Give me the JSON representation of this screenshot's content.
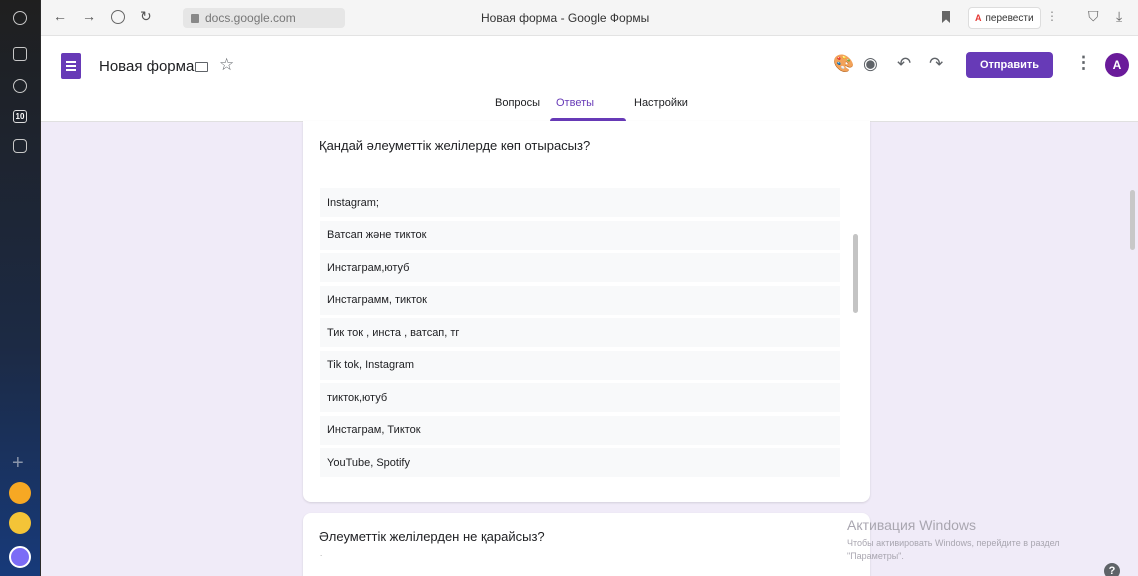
{
  "browser": {
    "url": "docs.google.com",
    "tab_title": "Новая форма - Google Формы",
    "translate_label": "перевести",
    "translate_icon_text": "A",
    "sidebar_badge": "10"
  },
  "form_header": {
    "title": "Новая форма",
    "send_label": "Отправить",
    "avatar_letter": "A",
    "tabs": [
      {
        "label": "Вопросы"
      },
      {
        "label": "Ответы"
      },
      {
        "label": "Настройки"
      }
    ]
  },
  "questions": [
    {
      "title": "Қандай әлеуметтік желілерде көп отырасыз?",
      "answers": [
        "Instagram;",
        "Ватсап және тикток",
        "Инстаграм,ютуб",
        "Инстаграмм, тикток",
        "Тик ток , инста , ватсап, тг",
        "Tik tok, Instagram",
        "тикток,ютуб",
        "Инстаграм, Тикток",
        "YouTube, Spotify"
      ]
    },
    {
      "title": "Әлеуметтік желілерден не қарайсыз?",
      "note": "."
    }
  ],
  "watermark": {
    "title": "Активация Windows",
    "line1": "Чтобы активировать Windows, перейдите в раздел",
    "line2": "\"Параметры\"."
  },
  "icons": {
    "help": "?",
    "kebab": "⋮",
    "star": "☆"
  },
  "colors": {
    "accent": "#673ab7",
    "background": "#f0ebf8",
    "avatar": "#6a1b9a"
  }
}
